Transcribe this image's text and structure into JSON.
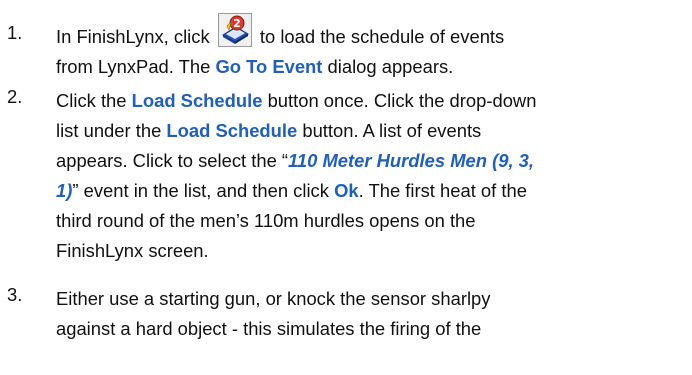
{
  "steps": [
    {
      "number": "1.",
      "lines": [
        {
          "a": "In FinishLynx, click ",
          "b": " to load the schedule of events"
        },
        {
          "a": "from LynxPad.  The ",
          "b": "Go To Event",
          "c": " dialog appears."
        }
      ]
    },
    {
      "number": "2.",
      "lines": [
        {
          "a": "Click the ",
          "b": "Load Schedule",
          "c": " button once.  Click the drop-down"
        },
        {
          "a": "list under the ",
          "b": "Load Schedule",
          "c": " button.  A list of events"
        },
        {
          "a": "appears.  Click to select the “",
          "b": "110 Meter Hurdles Men (9, 3,"
        },
        {
          "b": "1)",
          "c": "” event in the list, and then click ",
          "d": "Ok",
          "e": ". The first heat of the"
        },
        {
          "a": "third round of the men’s 110m hurdles opens on the"
        },
        {
          "a": "FinishLynx screen."
        }
      ]
    },
    {
      "number": "3.",
      "lines": [
        {
          "a": "Either use a starting gun, or knock the sensor sharlpy"
        },
        {
          "a": "against a hard object - this simulates the firing of the"
        }
      ]
    }
  ],
  "icon": {
    "name": "load-schedule-icon",
    "glyph": "2"
  }
}
